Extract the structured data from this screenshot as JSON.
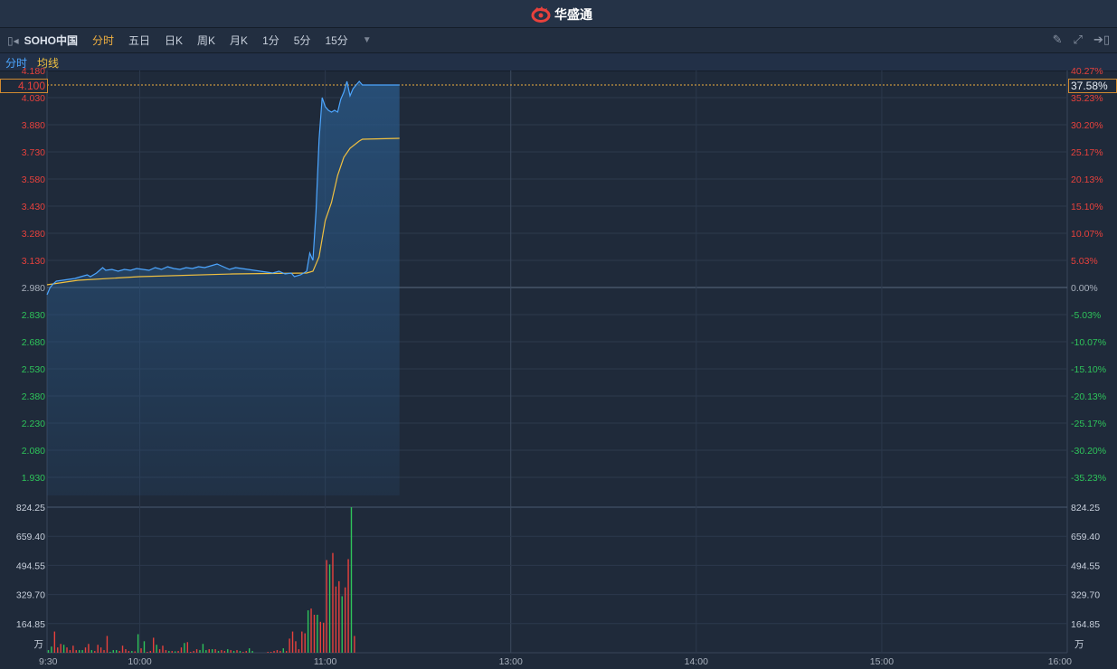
{
  "app": {
    "title": "华盛通",
    "logo_icon": "huasheng-logo"
  },
  "toolbar": {
    "stock_name": "SOHO中国",
    "tabs": [
      "分时",
      "五日",
      "日K",
      "周K",
      "月K",
      "1分",
      "5分",
      "15分"
    ],
    "active_tab": "分时",
    "right_icons": [
      "pencil-icon",
      "fullscreen-icon",
      "collapse-panel-icon"
    ]
  },
  "legend": {
    "price_label": "分时",
    "avg_label": "均线"
  },
  "current": {
    "price": "4.100",
    "percent": "37.58%"
  },
  "colors": {
    "up": "#e8413c",
    "down": "#2ec45a",
    "price_line": "#4da6ff",
    "avg_line": "#f0c040",
    "accent": "#f0b040"
  },
  "chart_data": {
    "type": "line",
    "title": "SOHO中国 分时",
    "prev_close": 2.98,
    "price_axis": {
      "ticks": [
        "4.180",
        "4.030",
        "3.880",
        "3.730",
        "3.580",
        "3.430",
        "3.280",
        "3.130",
        "2.980",
        "2.830",
        "2.680",
        "2.530",
        "2.380",
        "2.230",
        "2.080",
        "1.930"
      ]
    },
    "percent_axis": {
      "ticks": [
        "40.27%",
        "35.23%",
        "30.20%",
        "25.17%",
        "20.13%",
        "15.10%",
        "10.07%",
        "5.03%",
        "0.00%",
        "-5.03%",
        "-10.07%",
        "-15.10%",
        "-20.13%",
        "-25.17%",
        "-30.20%",
        "-35.23%"
      ]
    },
    "time_axis": {
      "ticks": [
        "9:30",
        "10:00",
        "11:00",
        "13:00",
        "14:00",
        "15:00",
        "16:00"
      ]
    },
    "x_unit": "minutes since 9:30",
    "series": [
      {
        "name": "分时",
        "points": [
          [
            0,
            2.94
          ],
          [
            1,
            2.98
          ],
          [
            2,
            3.0
          ],
          [
            3,
            3.015
          ],
          [
            5,
            3.02
          ],
          [
            7,
            3.025
          ],
          [
            9,
            3.03
          ],
          [
            11,
            3.04
          ],
          [
            13,
            3.05
          ],
          [
            14,
            3.04
          ],
          [
            16,
            3.06
          ],
          [
            18,
            3.09
          ],
          [
            19,
            3.075
          ],
          [
            21,
            3.08
          ],
          [
            23,
            3.07
          ],
          [
            25,
            3.08
          ],
          [
            27,
            3.075
          ],
          [
            29,
            3.085
          ],
          [
            31,
            3.08
          ],
          [
            33,
            3.075
          ],
          [
            35,
            3.09
          ],
          [
            37,
            3.08
          ],
          [
            39,
            3.095
          ],
          [
            41,
            3.085
          ],
          [
            43,
            3.08
          ],
          [
            45,
            3.09
          ],
          [
            47,
            3.085
          ],
          [
            49,
            3.095
          ],
          [
            51,
            3.09
          ],
          [
            53,
            3.1
          ],
          [
            55,
            3.11
          ],
          [
            57,
            3.095
          ],
          [
            59,
            3.08
          ],
          [
            61,
            3.09
          ],
          [
            63,
            3.085
          ],
          [
            65,
            3.08
          ],
          [
            67,
            3.075
          ],
          [
            69,
            3.07
          ],
          [
            71,
            3.065
          ],
          [
            73,
            3.06
          ],
          [
            75,
            3.07
          ],
          [
            77,
            3.055
          ],
          [
            79,
            3.06
          ],
          [
            80,
            3.04
          ],
          [
            82,
            3.05
          ],
          [
            84,
            3.07
          ],
          [
            85,
            3.17
          ],
          [
            86,
            3.13
          ],
          [
            87,
            3.4
          ],
          [
            88,
            3.8
          ],
          [
            89,
            4.03
          ],
          [
            90,
            3.98
          ],
          [
            91,
            3.96
          ],
          [
            92,
            3.95
          ],
          [
            93,
            3.96
          ],
          [
            94,
            3.95
          ],
          [
            95,
            4.02
          ],
          [
            96,
            4.06
          ],
          [
            97,
            4.12
          ],
          [
            98,
            4.04
          ],
          [
            99,
            4.08
          ],
          [
            100,
            4.1
          ],
          [
            101,
            4.12
          ],
          [
            102,
            4.1
          ],
          [
            114,
            4.1
          ]
        ]
      },
      {
        "name": "均线",
        "points": [
          [
            0,
            2.995
          ],
          [
            10,
            3.02
          ],
          [
            30,
            3.04
          ],
          [
            60,
            3.055
          ],
          [
            84,
            3.06
          ],
          [
            86,
            3.07
          ],
          [
            88,
            3.15
          ],
          [
            90,
            3.35
          ],
          [
            92,
            3.45
          ],
          [
            94,
            3.6
          ],
          [
            96,
            3.7
          ],
          [
            98,
            3.75
          ],
          [
            101,
            3.79
          ],
          [
            102,
            3.8
          ],
          [
            114,
            3.805
          ]
        ]
      }
    ],
    "volume": {
      "unit": "万",
      "ticks": [
        "824.25",
        "659.40",
        "494.55",
        "329.70",
        "164.85"
      ],
      "max": 824.25,
      "values": [
        15,
        35,
        120,
        30,
        50,
        45,
        30,
        15,
        40,
        15,
        15,
        15,
        30,
        50,
        15,
        10,
        45,
        30,
        15,
        95,
        5,
        15,
        15,
        10,
        40,
        20,
        10,
        10,
        8,
        105,
        25,
        65,
        5,
        10,
        85,
        45,
        20,
        40,
        15,
        10,
        10,
        8,
        10,
        30,
        55,
        60,
        5,
        10,
        20,
        15,
        50,
        15,
        20,
        20,
        20,
        10,
        15,
        10,
        20,
        15,
        10,
        15,
        10,
        5,
        10,
        25,
        10,
        0,
        0,
        0,
        0,
        5,
        5,
        10,
        15,
        10,
        25,
        10,
        80,
        120,
        65,
        20,
        120,
        110,
        240,
        250,
        215,
        215,
        175,
        170,
        525,
        500,
        565,
        375,
        405,
        320,
        370,
        530,
        824,
        95
      ],
      "directions": "ggrrrgrrrrggrrgrrrrrgggrrrrgrgrgrrrgrrrgrgrrgrrrrgggrgrgrrgrgrgrrggggrrrrrrrgrrrrrrrgrrgrrrgrrrgrrg"
    }
  }
}
